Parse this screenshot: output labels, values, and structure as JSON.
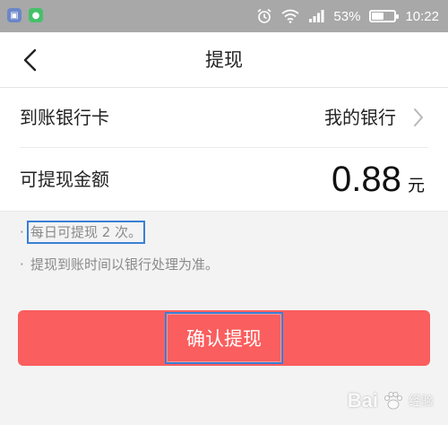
{
  "status_bar": {
    "battery_percent": "53%",
    "battery_level": 0.53,
    "time": "10:22",
    "icons": [
      "app-icon",
      "chat-app-icon",
      "alarm-icon",
      "wifi-icon",
      "signal-icon",
      "battery-icon"
    ]
  },
  "nav": {
    "title": "提现",
    "back_icon": "chevron-left-icon"
  },
  "card": {
    "bank_label": "到账银行卡",
    "bank_value": "我的银行",
    "amount_label": "可提现金额",
    "amount_value": "0.88",
    "amount_unit": "元"
  },
  "notes": [
    {
      "bullet": "·",
      "text": "每日可提现 2 次。"
    },
    {
      "bullet": "·",
      "text": "提现到账时间以银行处理为准。"
    }
  ],
  "confirm": {
    "label": "确认提现"
  },
  "watermark": {
    "text": "Bai",
    "text2": "经验",
    "url": "jingyan.baidu.com"
  },
  "colors": {
    "status_bar": "#a8a8a8",
    "primary_button": "#fb5e5e",
    "highlight_outline": "#3a7fd5",
    "page_background": "#f3f3f3"
  }
}
